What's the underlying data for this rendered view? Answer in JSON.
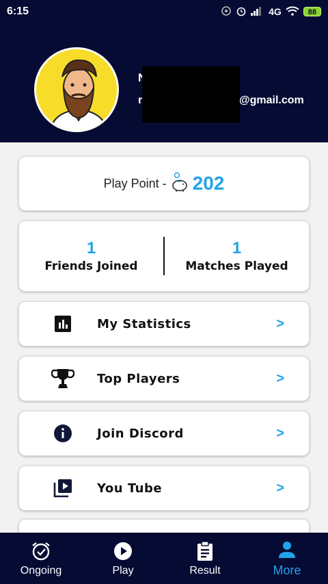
{
  "status_bar": {
    "time": "6:15",
    "network": "4G",
    "battery": "88"
  },
  "profile": {
    "name_initial": "N",
    "email_initial": "r",
    "email_domain": "@gmail.com"
  },
  "play_point": {
    "label": "Play Point -",
    "value": "202"
  },
  "stats": {
    "friends_joined": {
      "value": "1",
      "label": "Friends Joined"
    },
    "matches_played": {
      "value": "1",
      "label": "Matches Played"
    }
  },
  "menu": {
    "items": [
      {
        "label": "My Statistics",
        "icon": "bar-chart-icon"
      },
      {
        "label": "Top Players",
        "icon": "trophy-icon"
      },
      {
        "label": "Join Discord",
        "icon": "info-icon"
      },
      {
        "label": "You Tube",
        "icon": "video-library-icon"
      }
    ],
    "chevron": ">"
  },
  "bottom_nav": {
    "items": [
      {
        "label": "Ongoing",
        "icon": "alarm-icon"
      },
      {
        "label": "Play",
        "icon": "play-circle-icon"
      },
      {
        "label": "Result",
        "icon": "clipboard-icon"
      },
      {
        "label": "More",
        "icon": "person-icon"
      }
    ],
    "active": "More"
  },
  "colors": {
    "navy": "#050b33",
    "accent": "#22a3e8",
    "avatar_bg": "#f7dc2a"
  }
}
